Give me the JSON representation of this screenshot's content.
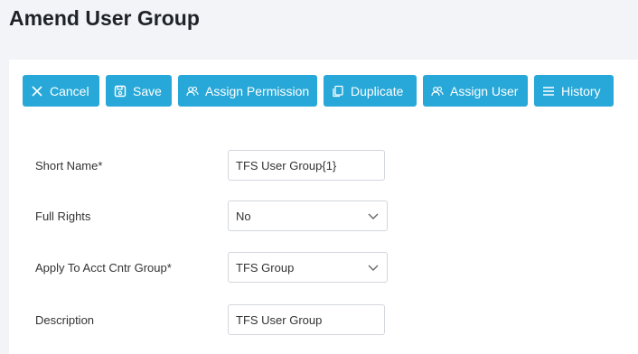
{
  "page": {
    "title": "Amend User Group"
  },
  "toolbar": {
    "cancel": {
      "label": "Cancel",
      "icon": "close-icon"
    },
    "save": {
      "label": "Save",
      "icon": "save-icon"
    },
    "assign_permission": {
      "label": "Assign Permission",
      "icon": "users-icon"
    },
    "duplicate": {
      "label": "Duplicate",
      "icon": "copy-icon"
    },
    "assign_user": {
      "label": "Assign User",
      "icon": "users-icon"
    },
    "history": {
      "label": "History",
      "icon": "menu-icon"
    },
    "accent": "#27a8d8"
  },
  "form": {
    "short_name": {
      "label": "Short Name*",
      "value": "TFS User Group{1}"
    },
    "full_rights": {
      "label": "Full Rights",
      "value": "No"
    },
    "acct_group": {
      "label": "Apply To Acct Cntr Group*",
      "value": "TFS Group"
    },
    "description": {
      "label": "Description",
      "value": "TFS User Group"
    }
  }
}
